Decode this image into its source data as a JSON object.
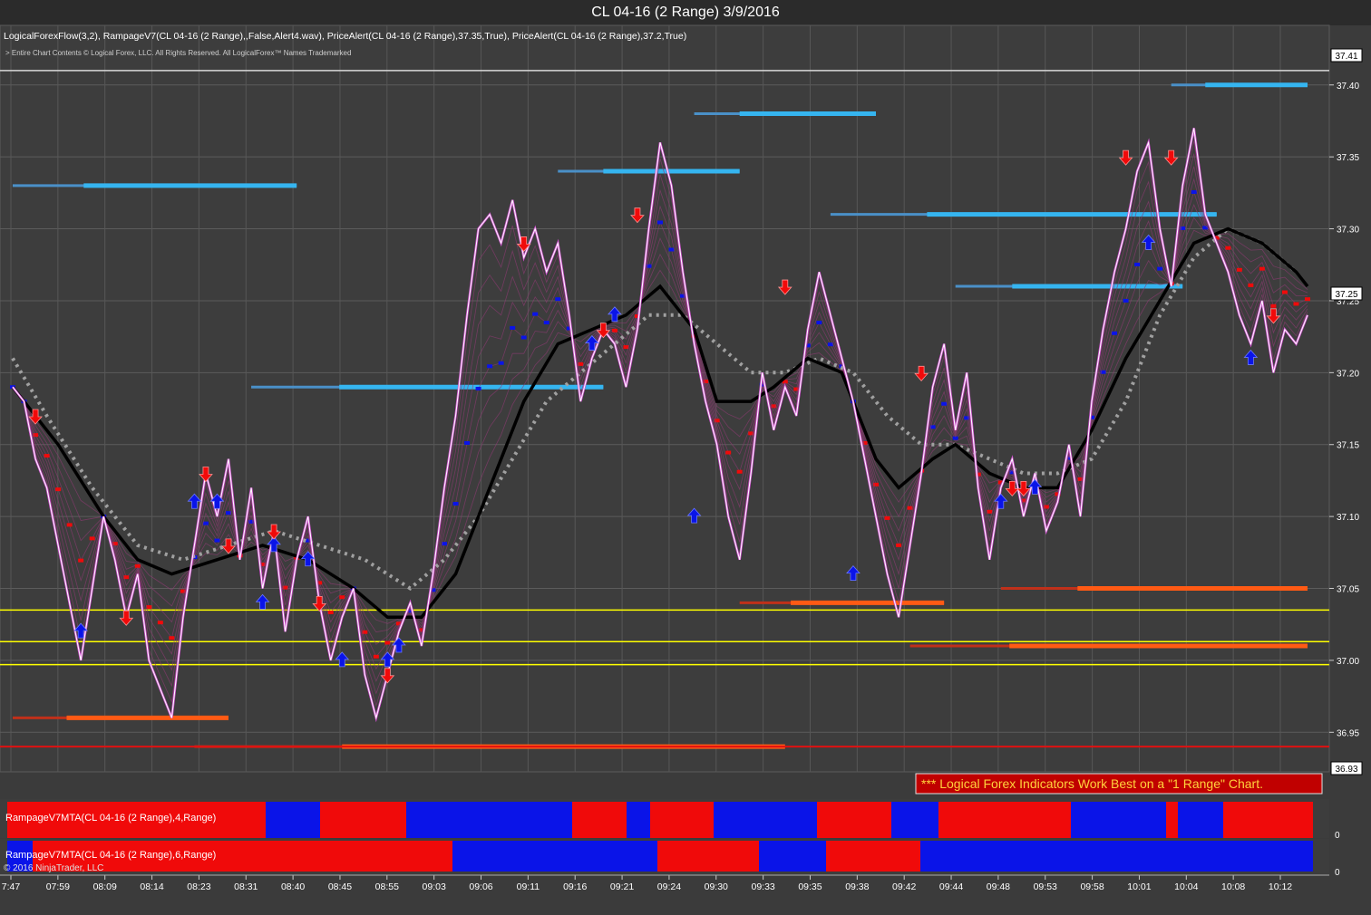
{
  "window_title": "CL 04-16 (2 Range)  3/9/2016",
  "indicator_line": "LogicalForexFlow(3,2),  RampageV7(CL 04-16 (2 Range),,False,Alert4.wav), PriceAlert(CL 04-16 (2 Range),37.35,True), PriceAlert(CL 04-16 (2 Range),37.2,True)",
  "copyright_line": "> Entire Chart Contents © Logical Forex, LLC. All Rights Reserved. All LogicalForex™ Names Trademarked",
  "notice": "*** Logical Forex Indicators Work Best on a \"1 Range\" Chart.",
  "panel1_label": "RampageV7MTA(CL 04-16 (2 Range),4,Range)",
  "panel2_label": "RampageV7MTA(CL 04-16 (2 Range),6,Range)",
  "ninja_copyright": "© 2016 NinjaTrader, LLC",
  "panel_zero": "0",
  "price_tags": {
    "top": "37.41",
    "current": "37.25",
    "bottom": "36.93"
  },
  "colors": {
    "up": "#0a14e8",
    "down": "#f00a0a",
    "price": "#ffffff",
    "fast_ma": "#000000",
    "slow_ma": "#a0a0a0",
    "support": "#ffff00",
    "resistance_zone": "#35b5f0",
    "support_zone": "#ff5a14"
  },
  "chart_data": {
    "type": "line",
    "title": "CL 04-16 (2 Range)  3/9/2016",
    "y_ticks": [
      36.95,
      37.0,
      37.05,
      37.1,
      37.15,
      37.2,
      37.25,
      37.3,
      37.35,
      37.4
    ],
    "ylim": [
      36.925,
      37.42
    ],
    "x_ticks": [
      "7:47",
      "07:59",
      "08:09",
      "08:14",
      "08:23",
      "08:31",
      "08:40",
      "08:45",
      "08:55",
      "09:03",
      "09:06",
      "09:11",
      "09:16",
      "09:21",
      "09:24",
      "09:30",
      "09:33",
      "09:35",
      "09:38",
      "09:42",
      "09:44",
      "09:48",
      "09:53",
      "09:58",
      "10:01",
      "10:04",
      "10:08",
      "10:12"
    ],
    "price_series": [
      [
        0,
        37.19
      ],
      [
        1,
        37.18
      ],
      [
        2,
        37.14
      ],
      [
        3,
        37.12
      ],
      [
        4,
        37.08
      ],
      [
        5,
        37.04
      ],
      [
        6,
        37.0
      ],
      [
        7,
        37.05
      ],
      [
        8,
        37.1
      ],
      [
        9,
        37.07
      ],
      [
        10,
        37.03
      ],
      [
        11,
        37.06
      ],
      [
        12,
        37.0
      ],
      [
        13,
        36.98
      ],
      [
        14,
        36.96
      ],
      [
        15,
        37.03
      ],
      [
        16,
        37.08
      ],
      [
        17,
        37.13
      ],
      [
        18,
        37.1
      ],
      [
        19,
        37.14
      ],
      [
        20,
        37.07
      ],
      [
        21,
        37.12
      ],
      [
        22,
        37.05
      ],
      [
        23,
        37.09
      ],
      [
        24,
        37.02
      ],
      [
        25,
        37.07
      ],
      [
        26,
        37.1
      ],
      [
        27,
        37.04
      ],
      [
        28,
        37.0
      ],
      [
        29,
        37.03
      ],
      [
        30,
        37.05
      ],
      [
        31,
        36.99
      ],
      [
        32,
        36.96
      ],
      [
        33,
        36.99
      ],
      [
        34,
        37.02
      ],
      [
        35,
        37.04
      ],
      [
        36,
        37.01
      ],
      [
        37,
        37.06
      ],
      [
        38,
        37.12
      ],
      [
        39,
        37.17
      ],
      [
        40,
        37.24
      ],
      [
        41,
        37.3
      ],
      [
        42,
        37.31
      ],
      [
        43,
        37.29
      ],
      [
        44,
        37.32
      ],
      [
        45,
        37.28
      ],
      [
        46,
        37.3
      ],
      [
        47,
        37.27
      ],
      [
        48,
        37.29
      ],
      [
        49,
        37.24
      ],
      [
        50,
        37.18
      ],
      [
        51,
        37.21
      ],
      [
        52,
        37.23
      ],
      [
        53,
        37.22
      ],
      [
        54,
        37.19
      ],
      [
        55,
        37.23
      ],
      [
        56,
        37.3
      ],
      [
        57,
        37.36
      ],
      [
        58,
        37.33
      ],
      [
        59,
        37.27
      ],
      [
        60,
        37.22
      ],
      [
        61,
        37.18
      ],
      [
        62,
        37.15
      ],
      [
        63,
        37.1
      ],
      [
        64,
        37.07
      ],
      [
        65,
        37.13
      ],
      [
        66,
        37.2
      ],
      [
        67,
        37.16
      ],
      [
        68,
        37.19
      ],
      [
        69,
        37.17
      ],
      [
        70,
        37.23
      ],
      [
        71,
        37.27
      ],
      [
        72,
        37.24
      ],
      [
        73,
        37.21
      ],
      [
        74,
        37.18
      ],
      [
        75,
        37.14
      ],
      [
        76,
        37.1
      ],
      [
        77,
        37.06
      ],
      [
        78,
        37.03
      ],
      [
        79,
        37.08
      ],
      [
        80,
        37.13
      ],
      [
        81,
        37.19
      ],
      [
        82,
        37.22
      ],
      [
        83,
        37.16
      ],
      [
        84,
        37.2
      ],
      [
        85,
        37.12
      ],
      [
        86,
        37.07
      ],
      [
        87,
        37.12
      ],
      [
        88,
        37.14
      ],
      [
        89,
        37.1
      ],
      [
        90,
        37.13
      ],
      [
        91,
        37.09
      ],
      [
        92,
        37.11
      ],
      [
        93,
        37.15
      ],
      [
        94,
        37.1
      ],
      [
        95,
        37.18
      ],
      [
        96,
        37.23
      ],
      [
        97,
        37.27
      ],
      [
        98,
        37.3
      ],
      [
        99,
        37.34
      ],
      [
        100,
        37.36
      ],
      [
        101,
        37.3
      ],
      [
        102,
        37.26
      ],
      [
        103,
        37.33
      ],
      [
        104,
        37.37
      ],
      [
        105,
        37.31
      ],
      [
        106,
        37.29
      ],
      [
        107,
        37.27
      ],
      [
        108,
        37.24
      ],
      [
        109,
        37.22
      ],
      [
        110,
        37.25
      ],
      [
        111,
        37.2
      ],
      [
        112,
        37.23
      ],
      [
        113,
        37.22
      ],
      [
        114,
        37.24
      ]
    ],
    "fast_ma": [
      [
        0,
        37.19
      ],
      [
        4,
        37.15
      ],
      [
        8,
        37.1
      ],
      [
        11,
        37.07
      ],
      [
        14,
        37.06
      ],
      [
        18,
        37.07
      ],
      [
        22,
        37.08
      ],
      [
        26,
        37.07
      ],
      [
        30,
        37.05
      ],
      [
        33,
        37.03
      ],
      [
        36,
        37.03
      ],
      [
        39,
        37.06
      ],
      [
        42,
        37.12
      ],
      [
        45,
        37.18
      ],
      [
        48,
        37.22
      ],
      [
        51,
        37.23
      ],
      [
        54,
        37.24
      ],
      [
        57,
        37.26
      ],
      [
        60,
        37.23
      ],
      [
        62,
        37.18
      ],
      [
        65,
        37.18
      ],
      [
        67,
        37.19
      ],
      [
        70,
        37.21
      ],
      [
        73,
        37.2
      ],
      [
        76,
        37.14
      ],
      [
        78,
        37.12
      ],
      [
        81,
        37.14
      ],
      [
        83,
        37.15
      ],
      [
        86,
        37.13
      ],
      [
        89,
        37.12
      ],
      [
        92,
        37.12
      ],
      [
        95,
        37.16
      ],
      [
        98,
        37.21
      ],
      [
        101,
        37.25
      ],
      [
        104,
        37.29
      ],
      [
        107,
        37.3
      ],
      [
        110,
        37.29
      ],
      [
        113,
        37.27
      ],
      [
        114,
        37.26
      ]
    ],
    "slow_ma": [
      [
        0,
        37.21
      ],
      [
        3,
        37.17
      ],
      [
        7,
        37.12
      ],
      [
        11,
        37.08
      ],
      [
        15,
        37.07
      ],
      [
        19,
        37.08
      ],
      [
        23,
        37.09
      ],
      [
        27,
        37.08
      ],
      [
        31,
        37.07
      ],
      [
        35,
        37.05
      ],
      [
        38,
        37.07
      ],
      [
        41,
        37.1
      ],
      [
        44,
        37.14
      ],
      [
        47,
        37.18
      ],
      [
        50,
        37.2
      ],
      [
        53,
        37.22
      ],
      [
        56,
        37.24
      ],
      [
        59,
        37.24
      ],
      [
        62,
        37.22
      ],
      [
        65,
        37.2
      ],
      [
        68,
        37.2
      ],
      [
        71,
        37.21
      ],
      [
        74,
        37.2
      ],
      [
        77,
        37.17
      ],
      [
        80,
        37.15
      ],
      [
        83,
        37.15
      ],
      [
        86,
        37.14
      ],
      [
        89,
        37.13
      ],
      [
        92,
        37.13
      ],
      [
        95,
        37.14
      ],
      [
        98,
        37.18
      ],
      [
        101,
        37.24
      ],
      [
        104,
        37.28
      ],
      [
        107,
        37.3
      ],
      [
        110,
        37.29
      ],
      [
        113,
        37.27
      ]
    ],
    "horizontal_lines": [
      {
        "price": 37.035,
        "color": "#ffff00"
      },
      {
        "price": 37.013,
        "color": "#ffff00"
      },
      {
        "price": 36.997,
        "color": "#ffff00"
      },
      {
        "price": 36.94,
        "color": "#e01010"
      },
      {
        "price": 37.41,
        "color": "#d8d8d8"
      }
    ],
    "zones": [
      {
        "x0": 0,
        "x1": 25,
        "price": 37.33,
        "kind": "resistance"
      },
      {
        "x0": 21,
        "x1": 52,
        "price": 37.19,
        "kind": "resistance"
      },
      {
        "x0": 48,
        "x1": 64,
        "price": 37.34,
        "kind": "resistance"
      },
      {
        "x0": 60,
        "x1": 76,
        "price": 37.38,
        "kind": "resistance"
      },
      {
        "x0": 72,
        "x1": 106,
        "price": 37.31,
        "kind": "resistance"
      },
      {
        "x0": 83,
        "x1": 103,
        "price": 37.26,
        "kind": "resistance"
      },
      {
        "x0": 102,
        "x1": 114,
        "price": 37.4,
        "kind": "resistance"
      },
      {
        "x0": 0,
        "x1": 19,
        "price": 36.96,
        "kind": "support"
      },
      {
        "x0": 16,
        "x1": 68,
        "price": 36.94,
        "kind": "support"
      },
      {
        "x0": 64,
        "x1": 82,
        "price": 37.04,
        "kind": "support"
      },
      {
        "x0": 79,
        "x1": 114,
        "price": 37.01,
        "kind": "support"
      },
      {
        "x0": 87,
        "x1": 114,
        "price": 37.05,
        "kind": "support"
      }
    ],
    "up_arrows": [
      [
        6,
        37.02
      ],
      [
        16,
        37.11
      ],
      [
        18,
        37.11
      ],
      [
        22,
        37.04
      ],
      [
        23,
        37.08
      ],
      [
        26,
        37.07
      ],
      [
        29,
        37.0
      ],
      [
        33,
        37.0
      ],
      [
        34,
        37.01
      ],
      [
        51,
        37.22
      ],
      [
        53,
        37.24
      ],
      [
        60,
        37.1
      ],
      [
        74,
        37.06
      ],
      [
        87,
        37.11
      ],
      [
        90,
        37.12
      ],
      [
        100,
        37.29
      ],
      [
        109,
        37.21
      ]
    ],
    "down_arrows": [
      [
        2,
        37.17
      ],
      [
        10,
        37.03
      ],
      [
        17,
        37.13
      ],
      [
        19,
        37.08
      ],
      [
        23,
        37.09
      ],
      [
        27,
        37.04
      ],
      [
        33,
        36.99
      ],
      [
        45,
        37.29
      ],
      [
        52,
        37.23
      ],
      [
        55,
        37.31
      ],
      [
        68,
        37.26
      ],
      [
        80,
        37.2
      ],
      [
        88,
        37.12
      ],
      [
        89,
        37.12
      ],
      [
        98,
        37.35
      ],
      [
        102,
        37.35
      ],
      [
        111,
        37.24
      ]
    ],
    "panel1_blocks": [
      [
        "#f00a0a",
        0,
        245
      ],
      [
        "#f00a0a",
        245,
        285
      ],
      [
        "#0a14e8",
        285,
        345
      ],
      [
        "#f00a0a",
        345,
        440
      ],
      [
        "#0a14e8",
        440,
        623
      ],
      [
        "#f00a0a",
        623,
        683
      ],
      [
        "#0a14e8",
        683,
        709
      ],
      [
        "#f00a0a",
        709,
        779
      ],
      [
        "#0a14e8",
        779,
        893
      ],
      [
        "#f00a0a",
        893,
        975
      ],
      [
        "#0a14e8",
        975,
        1027
      ],
      [
        "#f00a0a",
        1027,
        1173
      ],
      [
        "#0a14e8",
        1173,
        1278
      ],
      [
        "#f00a0a",
        1278,
        1291
      ],
      [
        "#0a14e8",
        1291,
        1341
      ],
      [
        "#f00a0a",
        1341,
        1440
      ]
    ],
    "panel2_blocks": [
      [
        "#0a14e8",
        0,
        28
      ],
      [
        "#f00a0a",
        28,
        491
      ],
      [
        "#0a14e8",
        491,
        717
      ],
      [
        "#f00a0a",
        717,
        829
      ],
      [
        "#0a14e8",
        829,
        903
      ],
      [
        "#f00a0a",
        903,
        1007
      ],
      [
        "#0a14e8",
        1007,
        1440
      ]
    ]
  }
}
